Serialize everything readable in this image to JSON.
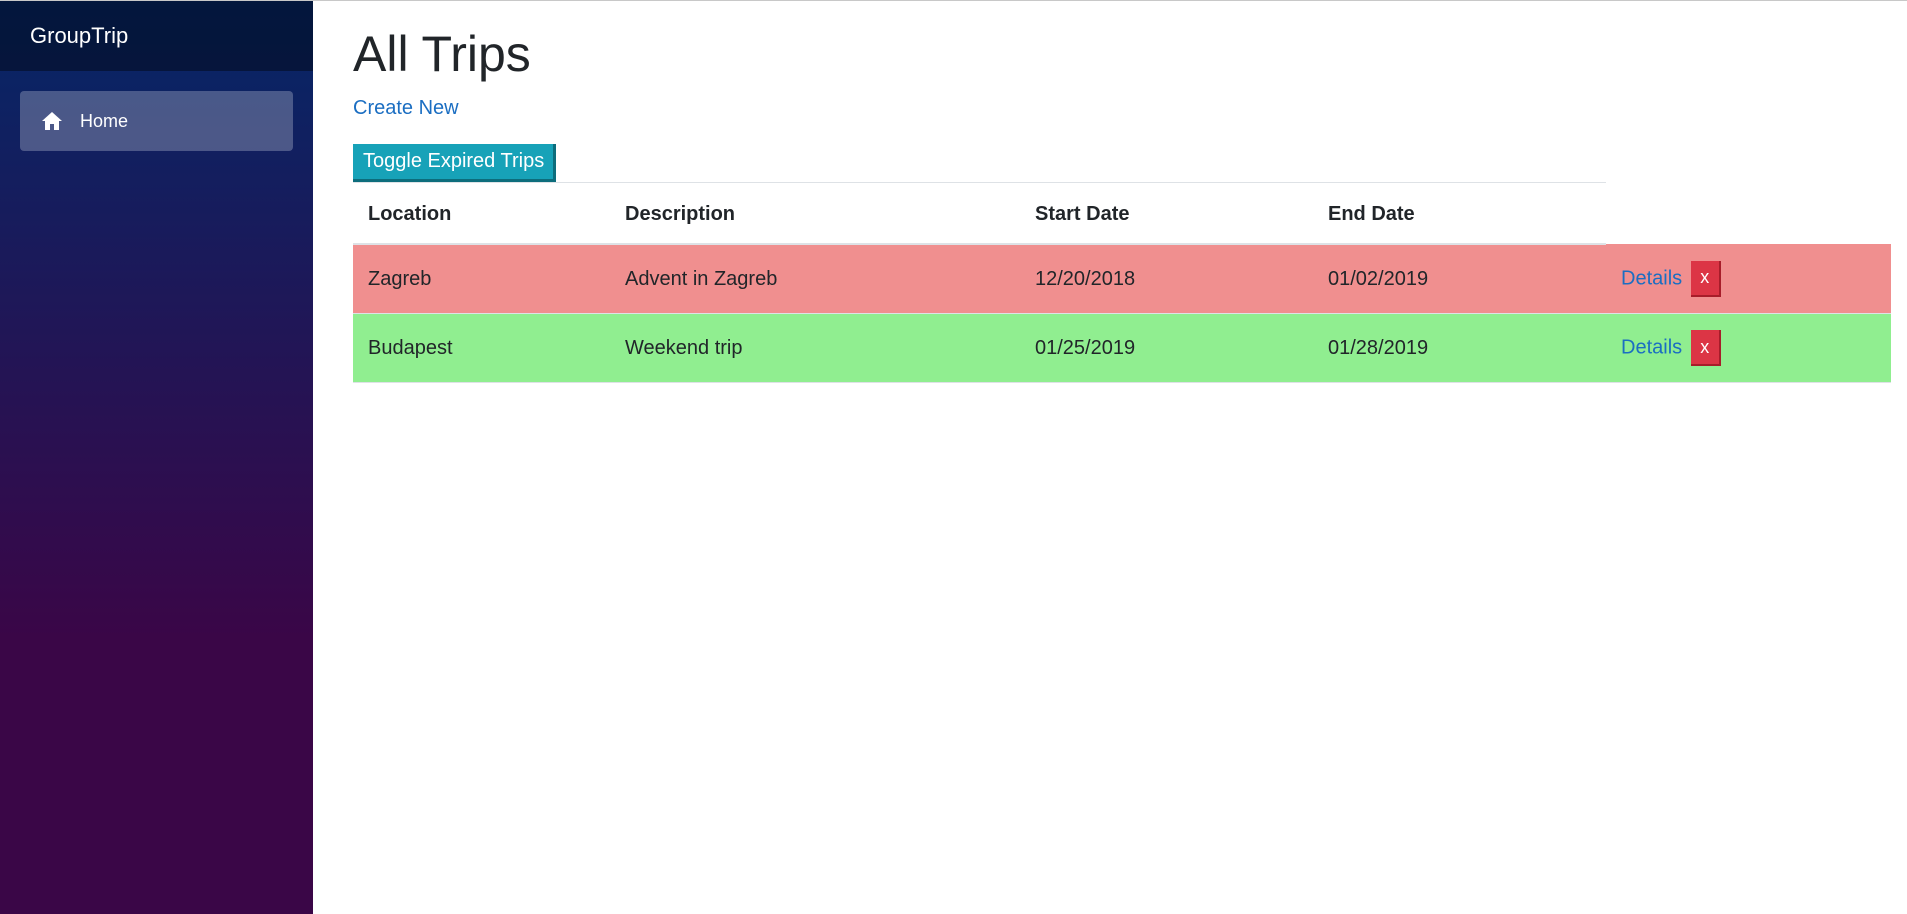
{
  "sidebar": {
    "brand": "GroupTrip",
    "items": [
      {
        "label": "Home",
        "icon": "home-icon"
      }
    ]
  },
  "main": {
    "title": "All Trips",
    "create_link": "Create New",
    "toggle_button": "Toggle Expired Trips"
  },
  "table": {
    "headers": {
      "location": "Location",
      "description": "Description",
      "start_date": "Start Date",
      "end_date": "End Date"
    },
    "rows": [
      {
        "location": "Zagreb",
        "description": "Advent in Zagreb",
        "start_date": "12/20/2018",
        "end_date": "01/02/2019",
        "status": "expired",
        "details_label": "Details",
        "delete_label": "x"
      },
      {
        "location": "Budapest",
        "description": "Weekend trip",
        "start_date": "01/25/2019",
        "end_date": "01/28/2019",
        "status": "active",
        "details_label": "Details",
        "delete_label": "x"
      }
    ]
  },
  "colors": {
    "expired_row": "#f08f8f",
    "active_row": "#90ee90",
    "toggle_button": "#17a2b8",
    "delete_button": "#dc3545",
    "link": "#1b6ec2"
  }
}
